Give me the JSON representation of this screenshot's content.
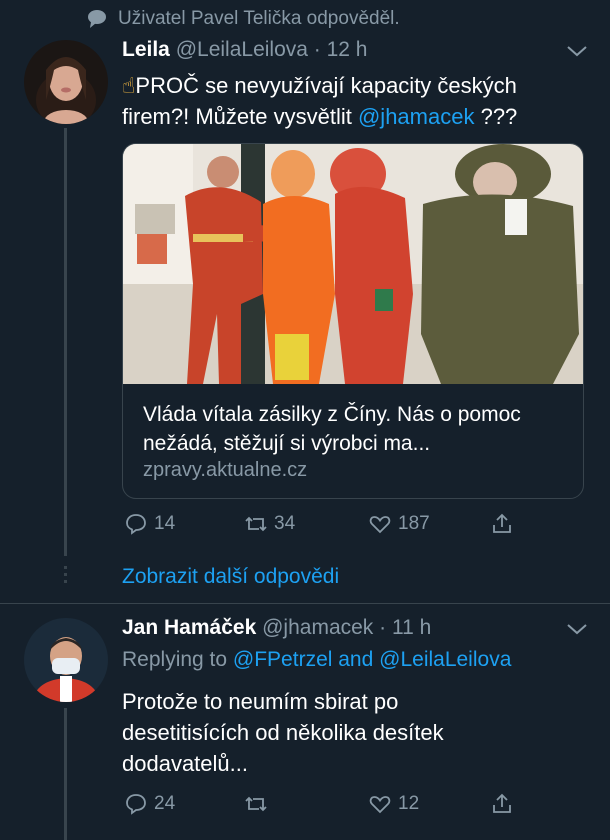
{
  "context": {
    "text": "Uživatel Pavel Telička odpověděl."
  },
  "tweet1": {
    "name": "Leila",
    "handle": "@LeilaLeilova",
    "time": "· 12 h",
    "emoji": "☝",
    "text_main": "PROČ se nevyužívají kapacity českých firem?! Můžete vysvětlit",
    "mention": "@jhamacek",
    "text_end": " ???",
    "card": {
      "title": "Vláda vítala zásilky z Číny. Nás o pomoc nežádá, stěžují si výrobci ma...",
      "domain": "zpravy.aktualne.cz"
    },
    "actions": {
      "replies": "14",
      "retweets": "34",
      "likes": "187"
    }
  },
  "show_more": "Zobrazit další odpovědi",
  "tweet2": {
    "name": "Jan Hamáček",
    "handle": "@jhamacek",
    "time": "· 11 h",
    "replying_prefix": "Replying to ",
    "reply_to_1": "@FPetrzel",
    "reply_and": " and ",
    "reply_to_2": "@LeilaLeilova",
    "text": "Protože to neumím sbirat po desetitisících od několika desítek dodavatelů...",
    "actions": {
      "replies": "24",
      "retweets": "",
      "likes": "12"
    }
  },
  "colors": {
    "background": "#15202b",
    "accent": "#1da1f2",
    "muted": "#8899a6",
    "line": "#38444d"
  }
}
